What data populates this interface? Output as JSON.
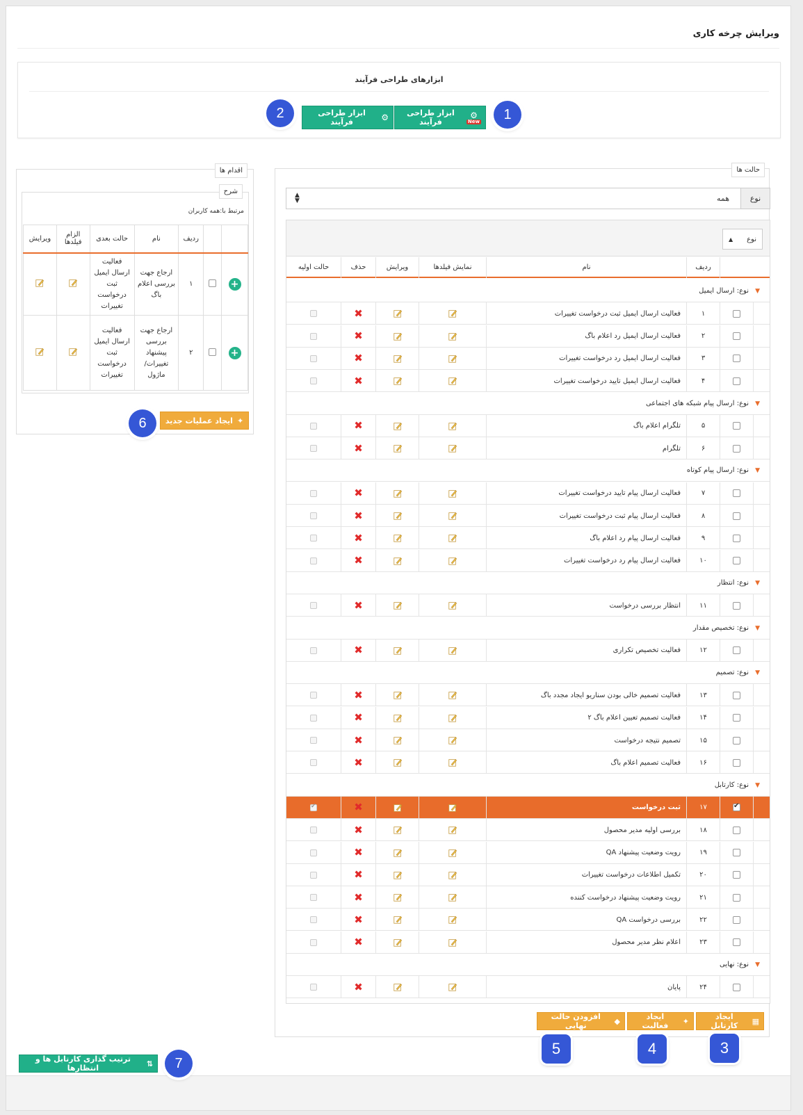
{
  "page_title": "ویرایش چرخه کاری",
  "tools": {
    "title": "ابزارهای طراحی فرآیند",
    "btn_new": "ابزار طراحی فرآیند",
    "btn_new_badge": "New",
    "btn_old": "ابزار طراحی فرآیند"
  },
  "callouts": [
    "1",
    "2",
    "3",
    "4",
    "5",
    "6",
    "7"
  ],
  "states": {
    "legend": "حالت ها",
    "type_label": "نوع",
    "type_value": "همه",
    "group_chip": "نوع",
    "columns": {
      "row_no": "ردیف",
      "name": "نام",
      "show_fields": "نمایش فیلدها",
      "edit": "ویرایش",
      "delete": "حذف",
      "initial_state": "حالت اولیه"
    },
    "groups": [
      {
        "title": "نوع: ارسال ایمیل",
        "rows": [
          {
            "no": "۱",
            "name": "فعالیت ارسال ایمیل ثبت درخواست تغییرات"
          },
          {
            "no": "۲",
            "name": "فعالیت ارسال ایمیل رد اعلام باگ"
          },
          {
            "no": "۳",
            "name": "فعالیت ارسال ایمیل رد درخواست تغییرات"
          },
          {
            "no": "۴",
            "name": "فعالیت ارسال ایمیل تایید درخواست تغییرات"
          }
        ]
      },
      {
        "title": "نوع: ارسال پیام شبکه های اجتماعی",
        "rows": [
          {
            "no": "۵",
            "name": "تلگرام اعلام باگ"
          },
          {
            "no": "۶",
            "name": "تلگرام"
          }
        ]
      },
      {
        "title": "نوع: ارسال پیام کوتاه",
        "rows": [
          {
            "no": "۷",
            "name": "فعالیت ارسال پیام تایید درخواست تغییرات"
          },
          {
            "no": "۸",
            "name": "فعالیت ارسال پیام ثبت درخواست تغییرات"
          },
          {
            "no": "۹",
            "name": "فعالیت ارسال پیام رد اعلام باگ"
          },
          {
            "no": "۱۰",
            "name": "فعالیت ارسال پیام رد درخواست تغییرات"
          }
        ]
      },
      {
        "title": "نوع: انتظار",
        "rows": [
          {
            "no": "۱۱",
            "name": "انتظار بررسی درخواست"
          }
        ]
      },
      {
        "title": "نوع: تخصیص مقدار",
        "rows": [
          {
            "no": "۱۲",
            "name": "فعالیت تخصیص تکراری"
          }
        ]
      },
      {
        "title": "نوع: تصمیم",
        "rows": [
          {
            "no": "۱۳",
            "name": "فعالیت تصمیم خالی بودن سناریو ایجاد مجدد باگ"
          },
          {
            "no": "۱۴",
            "name": "فعالیت تصمیم تعیین اعلام باگ ۲"
          },
          {
            "no": "۱۵",
            "name": "تصمیم نتیجه درخواست"
          },
          {
            "no": "۱۶",
            "name": "فعالیت تصمیم اعلام باگ"
          }
        ]
      },
      {
        "title": "نوع: کارتابل",
        "rows": [
          {
            "no": "۱۷",
            "name": "ثبت درخواست",
            "selected": true
          },
          {
            "no": "۱۸",
            "name": "بررسی اولیه مدیر محصول"
          },
          {
            "no": "۱۹",
            "name": "رویت وضعیت پیشنهاد QA"
          },
          {
            "no": "۲۰",
            "name": "تکمیل اطلاعات درخواست تغییرات"
          },
          {
            "no": "۲۱",
            "name": "رویت وضعیت پیشنهاد درخواست کننده"
          },
          {
            "no": "۲۲",
            "name": "بررسی درخواست QA"
          },
          {
            "no": "۲۳",
            "name": "اعلام نظر مدیر محصول"
          }
        ]
      },
      {
        "title": "نوع: نهایی",
        "rows": [
          {
            "no": "۲۴",
            "name": "پایان"
          }
        ]
      }
    ],
    "btn_create_cartable": "ایجاد کارتابل",
    "btn_create_activity": "ایجاد فعالیت",
    "btn_add_final": "افزودن حالت نهایی"
  },
  "actions": {
    "legend": "اقدام ها",
    "desc_legend": "شرح",
    "related_to": "مرتبط با:همه کاربران",
    "columns": {
      "row_no": "ردیف",
      "name": "نام",
      "next_state": "حالت بعدی",
      "required_fields": "الزام فیلدها",
      "edit": "ویرایش"
    },
    "rows": [
      {
        "no": "۱",
        "name": "ارجاع جهت بررسی اعلام باگ",
        "next": "فعالیت ارسال ایمیل ثبت درخواست تغییرات"
      },
      {
        "no": "۲",
        "name": "ارجاع جهت بررسی پیشنهاد تغییرات/ ماژول",
        "next": "فعالیت ارسال ایمیل ثبت درخواست تغییرات"
      }
    ],
    "btn_new_operation": "ایجاد عملیات جدید"
  },
  "footer": {
    "btn_order": "ترتیب گذاری کارتابل ها و انتظارها"
  },
  "colors": {
    "accent_orange": "#e86c2b",
    "green": "#21b089",
    "callout_blue": "#3557d6",
    "delete_red": "#e12b2b"
  }
}
